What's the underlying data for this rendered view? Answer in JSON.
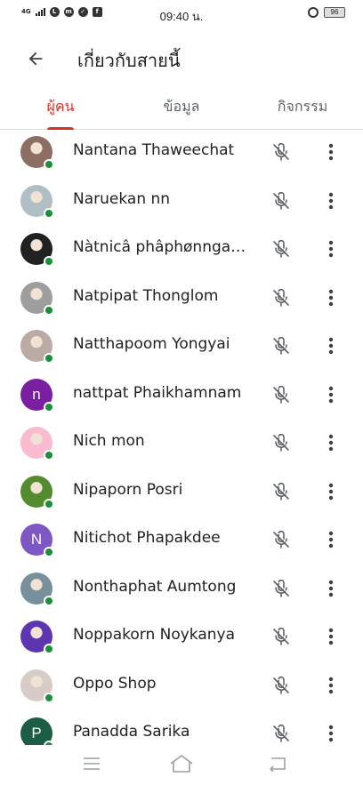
{
  "status_bar": {
    "network": "4G",
    "time": "09:40 น.",
    "battery": "96"
  },
  "header": {
    "title": "เกี่ยวกับสายนี้",
    "back_icon": "arrow-left-icon"
  },
  "tabs": [
    {
      "label": "ผู้คน",
      "active": true
    },
    {
      "label": "ข้อมูล",
      "active": false
    },
    {
      "label": "กิจกรรม",
      "active": false
    }
  ],
  "colors": {
    "accent": "#d93025",
    "presence": "#1e8e3e",
    "text": "#202124",
    "icon": "#5f6368"
  },
  "participants": [
    {
      "name": "Nantana Thaweechat",
      "avatar": "photo",
      "initial": "",
      "avatar_color": "#8d6e63"
    },
    {
      "name": "Naruekan nn",
      "avatar": "photo",
      "initial": "",
      "avatar_color": "#b0bec5"
    },
    {
      "name": "Nàtnicâ phâphønngamø",
      "avatar": "photo",
      "initial": "",
      "avatar_color": "#212121"
    },
    {
      "name": "Natpipat Thonglom",
      "avatar": "photo",
      "initial": "",
      "avatar_color": "#9e9e9e"
    },
    {
      "name": "Natthapoom Yongyai",
      "avatar": "photo",
      "initial": "",
      "avatar_color": "#bcaaa4"
    },
    {
      "name": "nattpat Phaikhamnam",
      "avatar": "initial",
      "initial": "n",
      "avatar_color": "#7b1fa2"
    },
    {
      "name": "Nich mon",
      "avatar": "photo",
      "initial": "",
      "avatar_color": "#f8bbd0"
    },
    {
      "name": "Nipaporn Posri",
      "avatar": "photo",
      "initial": "",
      "avatar_color": "#558b2f"
    },
    {
      "name": "Nitichot Phapakdee",
      "avatar": "initial",
      "initial": "N",
      "avatar_color": "#7e57c2"
    },
    {
      "name": "Nonthaphat Aumtong",
      "avatar": "photo",
      "initial": "",
      "avatar_color": "#78909c"
    },
    {
      "name": "Noppakorn Noykanya",
      "avatar": "photo",
      "initial": "",
      "avatar_color": "#5e35b1"
    },
    {
      "name": "Oppo Shop",
      "avatar": "photo",
      "initial": "",
      "avatar_color": "#d7ccc8"
    },
    {
      "name": "Panadda Sarika",
      "avatar": "initial",
      "initial": "P",
      "avatar_color": "#1b5e45"
    }
  ],
  "row_icons": {
    "mic": "mic-off-icon",
    "more": "more-vert-icon"
  },
  "nav": {
    "menu": "menu-icon",
    "home": "home-icon",
    "back": "back-icon"
  }
}
